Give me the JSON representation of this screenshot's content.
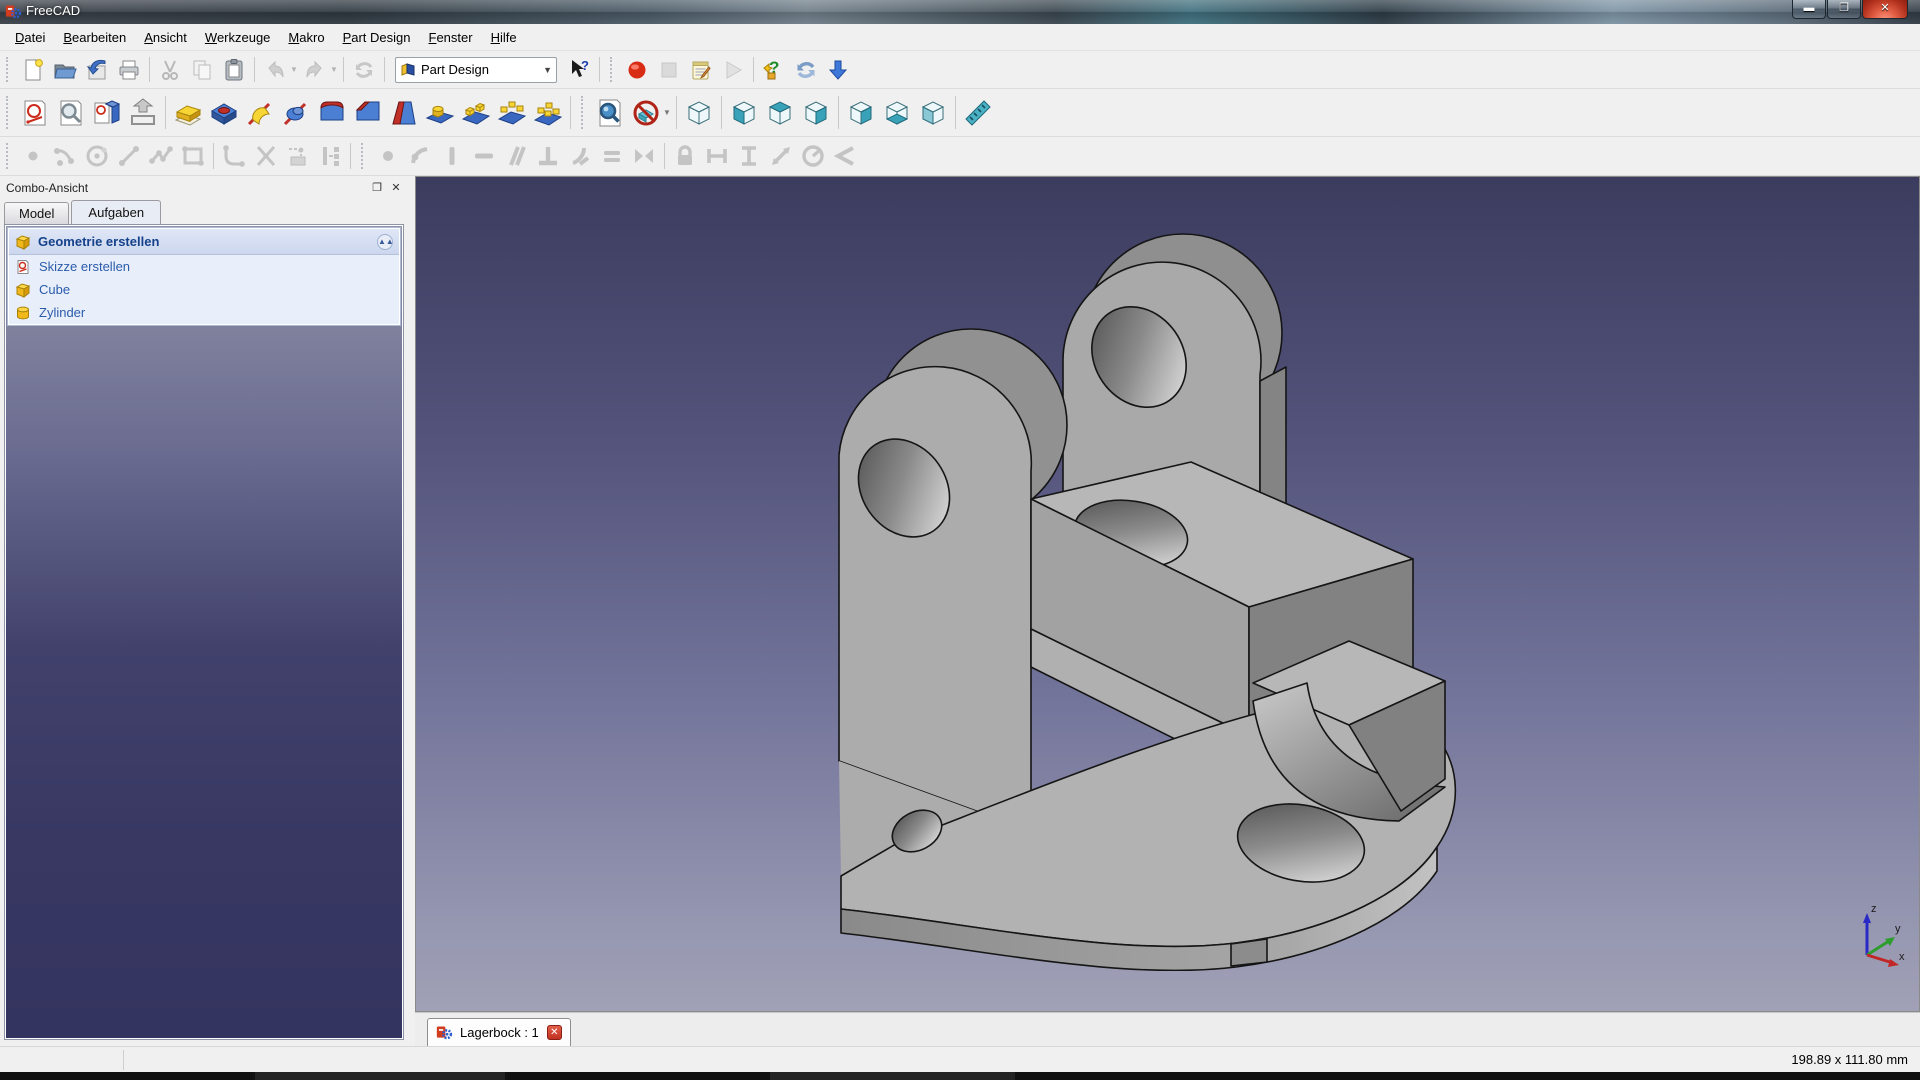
{
  "window": {
    "title": "FreeCAD",
    "buttons": [
      "minimize",
      "restore",
      "close"
    ]
  },
  "menubar": {
    "items": [
      {
        "accel": "D",
        "rest": "atei"
      },
      {
        "accel": "B",
        "rest": "earbeiten"
      },
      {
        "accel": "A",
        "rest": "nsicht"
      },
      {
        "accel": "W",
        "rest": "erkzeuge"
      },
      {
        "accel": "M",
        "rest": "akro"
      },
      {
        "accel": "P",
        "rest": "art Design"
      },
      {
        "accel": "F",
        "rest": "enster"
      },
      {
        "accel": "H",
        "rest": "ilfe"
      }
    ]
  },
  "toolbars": {
    "file": {
      "icons": [
        "new",
        "open",
        "save",
        "print",
        "cut",
        "copy",
        "paste",
        "undo",
        "redo",
        "refresh"
      ],
      "disabled": [
        "cut",
        "copy",
        "undo",
        "redo",
        "refresh"
      ]
    },
    "workbench_selector": {
      "value": "Part Design"
    },
    "help": {
      "icons": [
        "whats-this"
      ]
    },
    "macro": {
      "icons": [
        "record",
        "stop",
        "edit-macro",
        "play"
      ],
      "disabled": [
        "stop",
        "play"
      ]
    },
    "web": {
      "icons": [
        "python-help",
        "web-refresh",
        "download"
      ]
    },
    "part_design": {
      "icons": [
        "create-sketch",
        "view-sketch",
        "map-sketch",
        "leave-sketch",
        "pad",
        "pocket",
        "revolution",
        "groove",
        "fillet",
        "chamfer",
        "draft",
        "mirrored",
        "linear-pattern",
        "polar-pattern",
        "multi-transform"
      ]
    },
    "view": {
      "icons": [
        "fit-all",
        "draw-style",
        "axonometric",
        "front",
        "top",
        "right",
        "rear",
        "bottom",
        "left",
        "measure"
      ]
    },
    "sketcher_geometry": {
      "disabled": true,
      "icons": [
        "point",
        "arc",
        "circle",
        "line",
        "polyline",
        "rectangle",
        "fillet-sketch",
        "trim",
        "external-geometry",
        "construction-mode"
      ]
    },
    "sketcher_constraints": {
      "disabled": true,
      "icons": [
        "coincident",
        "point-on-object",
        "vertical",
        "horizontal",
        "parallel",
        "perpendicular",
        "tangent",
        "equal",
        "symmetric",
        "lock",
        "horizontal-distance",
        "vertical-distance",
        "distance",
        "radius",
        "angle"
      ]
    }
  },
  "combo_view": {
    "title": "Combo-Ansicht",
    "tabs": [
      {
        "label": "Model",
        "active": false
      },
      {
        "label": "Aufgaben",
        "active": true
      }
    ],
    "task_panel": {
      "header": "Geometrie erstellen",
      "items": [
        {
          "icon": "sketch",
          "label": "Skizze erstellen"
        },
        {
          "icon": "cube",
          "label": "Cube"
        },
        {
          "icon": "cylinder",
          "label": "Zylinder"
        }
      ]
    }
  },
  "mdi": {
    "tabs": [
      {
        "icon": "freecad",
        "label": "Lagerbock : 1",
        "active": true,
        "closable": true
      }
    ]
  },
  "viewport": {
    "model_name": "Lagerbock",
    "background_top": "#3c3c5f",
    "background_bottom": "#a0a1b6",
    "axes": {
      "x": "x",
      "y": "y",
      "z": "z"
    },
    "axis_colors": {
      "x": "#c22727",
      "y": "#2d9e2d",
      "z": "#2929c8"
    }
  },
  "statusbar": {
    "size_readout": "198.89 x 111.80 mm"
  },
  "colors": {
    "task_header_text": "#15428b",
    "task_link_text": "#2a5caa",
    "close_button_red": "#c03020"
  }
}
